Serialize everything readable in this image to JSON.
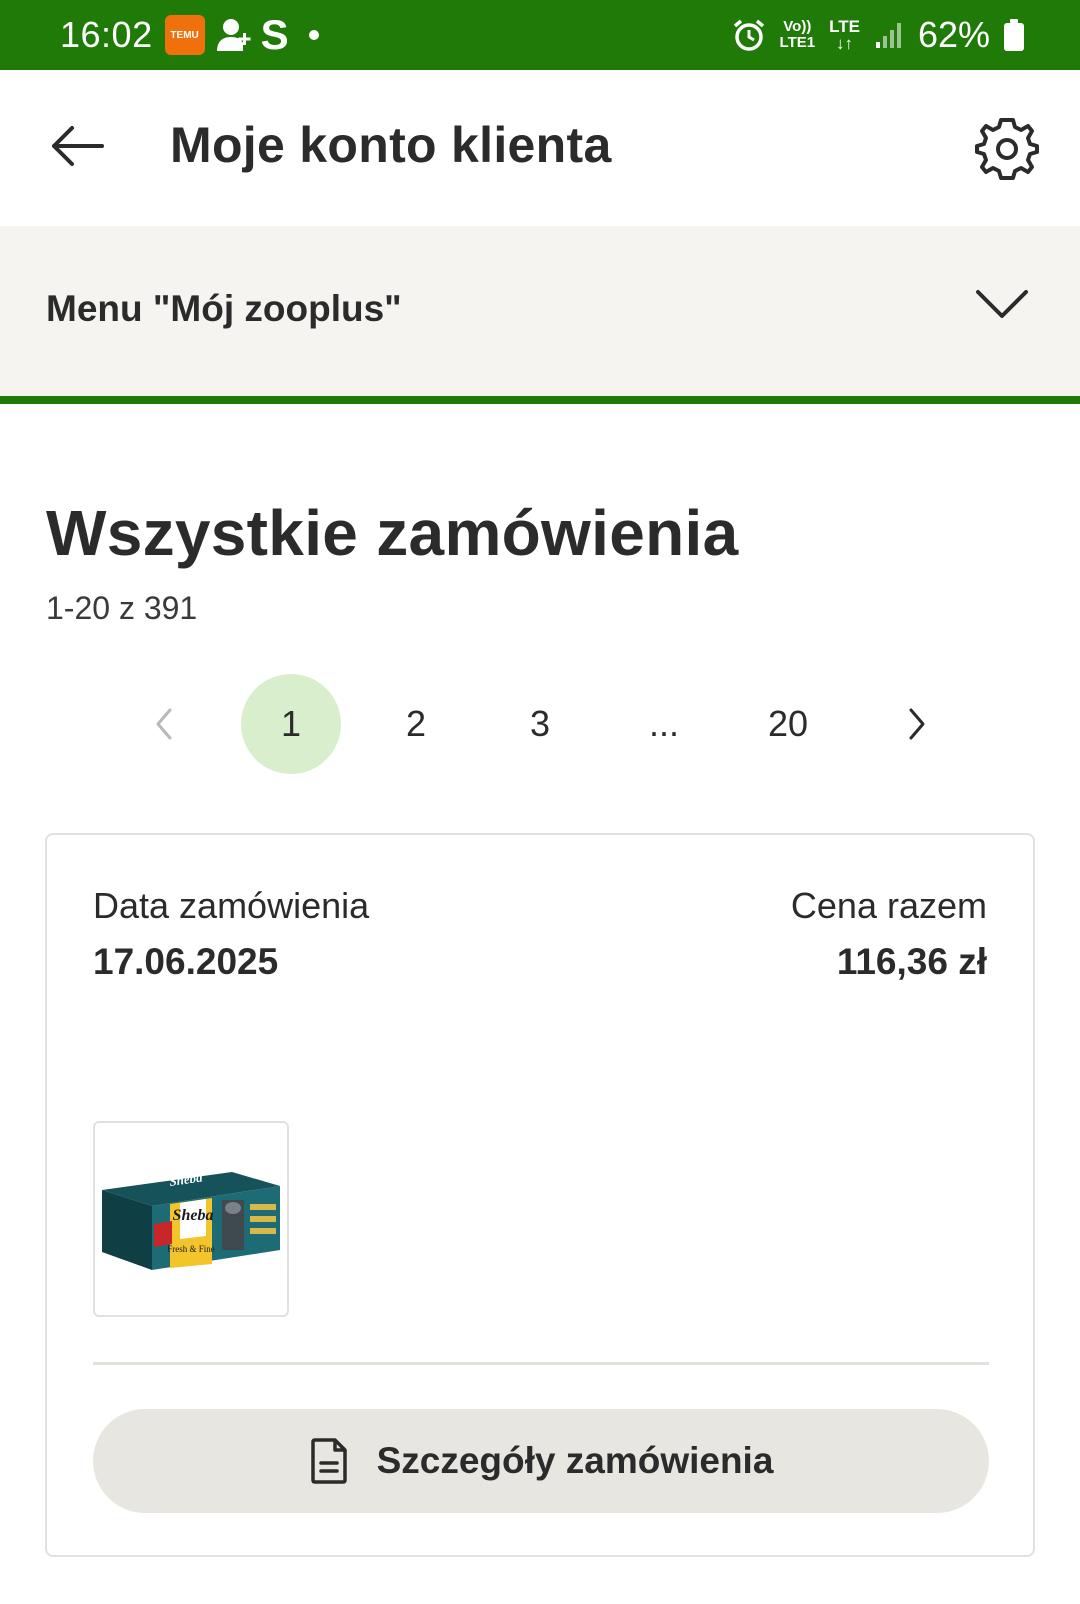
{
  "status_bar": {
    "time": "16:02",
    "temu_badge": "TEMU",
    "s_letter": "S",
    "volte_line1": "Vo))",
    "volte_line2": "LTE1",
    "lte": "LTE",
    "battery": "62%"
  },
  "app_bar": {
    "title": "Moje konto klienta",
    "back_icon": "arrow-left-icon",
    "settings_icon": "gear-icon"
  },
  "menu": {
    "label": "Menu \"Mój zooplus\"",
    "icon": "chevron-down-icon"
  },
  "orders": {
    "heading": "Wszystkie zamówienia",
    "count": "1-20 z 391"
  },
  "pagination": {
    "current": "1",
    "pages": [
      "1",
      "2",
      "3",
      "...",
      "20"
    ]
  },
  "order_card": {
    "date_label": "Data zamówienia",
    "date": "17.06.2025",
    "price_label": "Cena razem",
    "price": "116,36 zł",
    "product_brand": "Sheba",
    "product_name": "Fresh & Fine",
    "details_button": "Szczegóły zamówienia"
  },
  "colors": {
    "brand_green": "#1f7a08",
    "active_page": "#d8eecd",
    "menu_bg": "#f5f4f1",
    "button_bg": "#e8e6e1"
  }
}
